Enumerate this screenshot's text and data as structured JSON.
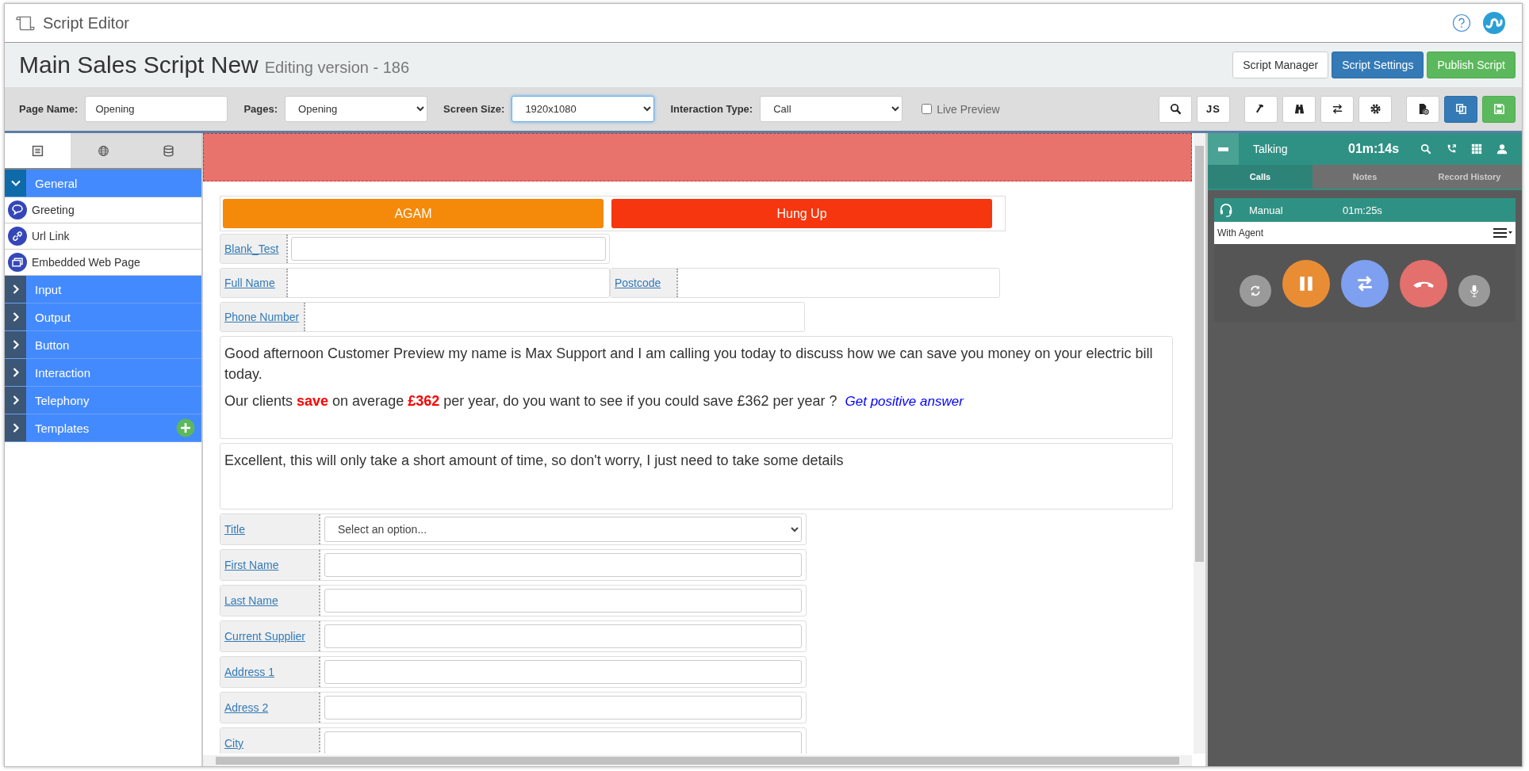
{
  "app": {
    "title": "Script Editor"
  },
  "header": {
    "script_name": "Main Sales Script New",
    "version": "Editing version - 186",
    "buttons": [
      {
        "label": "Script Manager",
        "kind": "default"
      },
      {
        "label": "Script Settings",
        "kind": "primary"
      },
      {
        "label": "Publish Script",
        "kind": "success"
      }
    ]
  },
  "toolbar": {
    "page_name": {
      "label": "Page Name:",
      "value": "Opening"
    },
    "pages": {
      "label": "Pages:",
      "value": "Opening"
    },
    "screen_size": {
      "label": "Screen Size:",
      "value": "1920x1080"
    },
    "interaction_type": {
      "label": "Interaction Type:",
      "value": "Call"
    },
    "live_preview": {
      "label": "Live Preview",
      "checked": false
    },
    "tool_buttons": [
      {
        "kind": "search"
      },
      {
        "kind": "js",
        "label": "JS"
      },
      {
        "kind": "hammer"
      },
      {
        "kind": "binoculars"
      },
      {
        "kind": "swap"
      },
      {
        "kind": "gear"
      },
      {
        "kind": "new-page"
      },
      {
        "kind": "copy"
      },
      {
        "kind": "save"
      }
    ]
  },
  "sidebar": {
    "tabs": [
      {
        "kind": "page",
        "selected": true
      },
      {
        "kind": "globe",
        "selected": false
      },
      {
        "kind": "database",
        "selected": false
      }
    ],
    "categories": [
      {
        "label": "General",
        "expanded": true,
        "children": [
          {
            "label": "Greeting",
            "kind": "speech"
          },
          {
            "label": "Url Link",
            "kind": "link"
          },
          {
            "label": "Embedded Web Page",
            "kind": "window"
          }
        ]
      },
      {
        "label": "Input",
        "expanded": false
      },
      {
        "label": "Output",
        "expanded": false
      },
      {
        "label": "Button",
        "expanded": false
      },
      {
        "label": "Interaction",
        "expanded": false
      },
      {
        "label": "Telephony",
        "expanded": false
      },
      {
        "label": "Templates",
        "expanded": false,
        "addable": true
      }
    ]
  },
  "canvas": {
    "buttons": [
      {
        "label": "AGAM",
        "color": "#f5890a"
      },
      {
        "label": "Hung Up",
        "color": "#f5360f"
      }
    ],
    "field_rows": [
      [
        {
          "label": "Blank_Test"
        }
      ],
      [
        {
          "label": "Full Name"
        },
        {
          "label": "Postcode"
        }
      ],
      [
        {
          "label": "Phone Number"
        }
      ]
    ],
    "text_blocks": [
      {
        "paragraphs": [
          "Good afternoon Customer Preview my name is Max Support and I am calling you today to discuss how we can save you money on your electric bill today.",
          "Our clients **save** on average **£362** per year, do you want to see if you could save £362 per year ?"
        ],
        "link": "Get positive answer"
      },
      {
        "paragraphs": [
          "Excellent, this will only take a short amount of time, so don't worry, I just need to take some details"
        ]
      }
    ],
    "form": [
      {
        "label": "Title",
        "kind": "select",
        "placeholder": "Select an option..."
      },
      {
        "label": "First Name",
        "kind": "input"
      },
      {
        "label": "Last Name",
        "kind": "input"
      },
      {
        "label": "Current Supplier",
        "kind": "input"
      },
      {
        "label": "Address 1",
        "kind": "input"
      },
      {
        "label": "Adress 2",
        "kind": "input"
      },
      {
        "label": "City",
        "kind": "input"
      }
    ]
  },
  "softphone": {
    "status": "Talking",
    "timer": "01m:14s",
    "tabs": [
      {
        "label": "Calls",
        "selected": true
      },
      {
        "label": "Notes",
        "selected": false
      },
      {
        "label": "Record History",
        "selected": false
      }
    ],
    "call": {
      "type": "Manual",
      "duration": "01m:25s",
      "state": "With Agent"
    },
    "controls": [
      {
        "kind": "refresh"
      },
      {
        "kind": "hold"
      },
      {
        "kind": "transfer"
      },
      {
        "kind": "hangup"
      },
      {
        "kind": "mic"
      }
    ]
  }
}
